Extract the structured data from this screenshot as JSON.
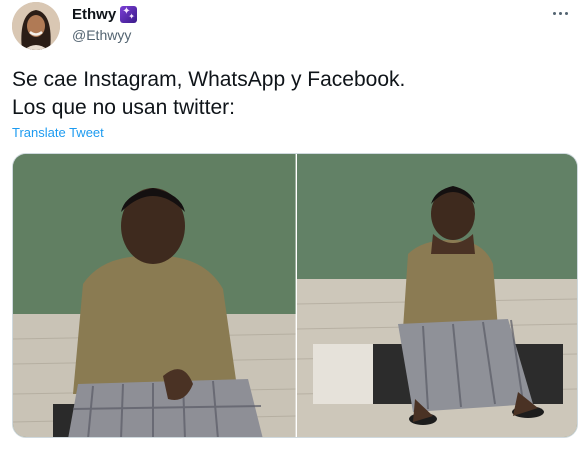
{
  "author": {
    "display_name": "Ethwy",
    "name_emoji": "sparkle-emoji",
    "handle": "@Ethwyy"
  },
  "tweet": {
    "lines": [
      "Se cae Instagram, WhatsApp y Facebook.",
      "Los que no usan twitter:"
    ],
    "translate_label": "Translate Tweet"
  },
  "icons": {
    "more": "more-options-icon"
  },
  "colors": {
    "text": "#0f1419",
    "secondary": "#536471",
    "link": "#1d9bf0",
    "border": "#cfd9de"
  }
}
